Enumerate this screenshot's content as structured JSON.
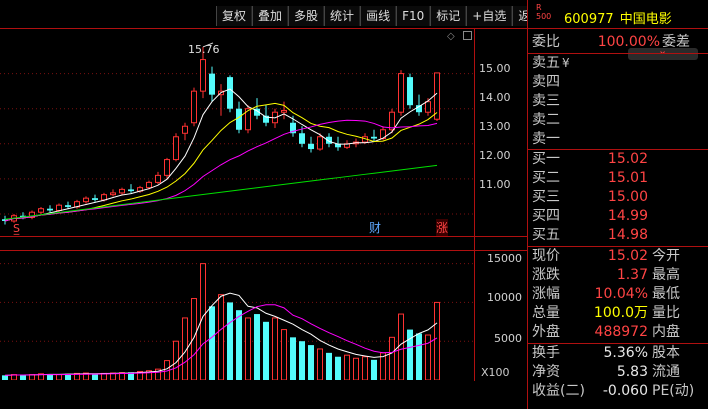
{
  "toolbar": {
    "buttons": [
      "复权",
      "叠加",
      "多股",
      "统计",
      "画线",
      "F10",
      "标记",
      "+自选",
      "返回"
    ]
  },
  "stock": {
    "r_label_top": "R",
    "r_label_bottom": "500",
    "code": "600977",
    "name": "中国电影"
  },
  "chart": {
    "high_annotation": "15.76",
    "price_axis": [
      "15.00",
      "14.00",
      "13.00",
      "12.00",
      "11.00"
    ],
    "vol_axis": [
      "15000",
      "10000",
      "5000"
    ],
    "vol_unit": "X100",
    "markers": {
      "s": "S̲",
      "cai": "财",
      "zhang": "涨"
    },
    "colors": {
      "up": "#ff3232",
      "down": "#54fcfc",
      "ma5": "#ffffff",
      "ma10": "#ffff00",
      "ma20": "#ff00ff",
      "ma60": "#00e000",
      "frame": "#b01010"
    }
  },
  "chart_data": {
    "type": "candlestick",
    "candles": [
      [
        10.85,
        10.95,
        10.7,
        10.8
      ],
      [
        10.8,
        11.0,
        10.75,
        10.95
      ],
      [
        10.95,
        11.05,
        10.85,
        10.9
      ],
      [
        10.9,
        11.1,
        10.85,
        11.05
      ],
      [
        11.05,
        11.2,
        11.0,
        11.15
      ],
      [
        11.15,
        11.25,
        11.05,
        11.1
      ],
      [
        11.1,
        11.3,
        11.05,
        11.25
      ],
      [
        11.25,
        11.35,
        11.15,
        11.2
      ],
      [
        11.2,
        11.4,
        11.15,
        11.35
      ],
      [
        11.35,
        11.5,
        11.3,
        11.45
      ],
      [
        11.45,
        11.55,
        11.35,
        11.4
      ],
      [
        11.4,
        11.6,
        11.35,
        11.55
      ],
      [
        11.55,
        11.7,
        11.5,
        11.6
      ],
      [
        11.6,
        11.75,
        11.55,
        11.7
      ],
      [
        11.7,
        11.85,
        11.6,
        11.65
      ],
      [
        11.65,
        11.8,
        11.6,
        11.75
      ],
      [
        11.75,
        11.95,
        11.7,
        11.9
      ],
      [
        11.9,
        12.2,
        11.85,
        12.1
      ],
      [
        12.1,
        12.6,
        12.0,
        12.55
      ],
      [
        12.55,
        13.3,
        12.5,
        13.2
      ],
      [
        13.3,
        13.6,
        13.1,
        13.5
      ],
      [
        13.6,
        14.6,
        13.5,
        14.5
      ],
      [
        14.5,
        15.76,
        14.3,
        15.4
      ],
      [
        15.0,
        15.2,
        14.2,
        14.4
      ],
      [
        14.4,
        14.7,
        13.8,
        14.5
      ],
      [
        14.9,
        14.95,
        13.9,
        14.0
      ],
      [
        14.0,
        14.2,
        13.3,
        13.4
      ],
      [
        13.4,
        14.1,
        13.3,
        14.0
      ],
      [
        14.0,
        14.3,
        13.7,
        13.8
      ],
      [
        13.8,
        14.1,
        13.5,
        13.6
      ],
      [
        13.6,
        14.0,
        13.45,
        13.9
      ],
      [
        13.9,
        14.2,
        13.7,
        13.95
      ],
      [
        13.6,
        13.8,
        13.2,
        13.3
      ],
      [
        13.3,
        13.5,
        12.9,
        13.0
      ],
      [
        13.0,
        13.2,
        12.75,
        12.85
      ],
      [
        12.85,
        13.3,
        12.8,
        13.2
      ],
      [
        13.2,
        13.3,
        12.9,
        13.0
      ],
      [
        13.0,
        13.2,
        12.8,
        12.9
      ],
      [
        12.9,
        13.1,
        12.85,
        13.0
      ],
      [
        13.0,
        13.15,
        12.9,
        13.05
      ],
      [
        13.05,
        13.3,
        13.0,
        13.2
      ],
      [
        13.2,
        13.4,
        13.05,
        13.15
      ],
      [
        13.15,
        13.5,
        13.1,
        13.4
      ],
      [
        13.4,
        14.0,
        13.3,
        13.9
      ],
      [
        13.9,
        15.1,
        13.8,
        15.0
      ],
      [
        14.9,
        15.0,
        14.0,
        14.1
      ],
      [
        14.1,
        14.4,
        13.8,
        13.9
      ],
      [
        13.9,
        14.3,
        13.8,
        14.2
      ],
      [
        13.7,
        15.02,
        13.65,
        15.02
      ]
    ],
    "volumes": [
      600,
      700,
      650,
      700,
      800,
      750,
      700,
      800,
      850,
      900,
      800,
      850,
      900,
      950,
      1000,
      1100,
      1200,
      1400,
      2500,
      5000,
      8000,
      10500,
      15000,
      9500,
      11000,
      10000,
      9000,
      8000,
      8500,
      7500,
      8000,
      6500,
      5500,
      5000,
      4500,
      4000,
      3500,
      3000,
      3200,
      2800,
      3000,
      2600,
      3500,
      5500,
      8500,
      6500,
      6000,
      5800,
      10000
    ]
  },
  "orders": {
    "weibi_label": "委比",
    "weibi_value": "100.00%",
    "weicha_label": "委差",
    "sell": [
      {
        "label": "卖五",
        "price": "",
        "vol": "",
        "extra": "¥"
      },
      {
        "label": "卖四",
        "price": "",
        "vol": ""
      },
      {
        "label": "卖三",
        "price": "",
        "vol": ""
      },
      {
        "label": "卖二",
        "price": "",
        "vol": ""
      },
      {
        "label": "卖一",
        "price": "",
        "vol": ""
      }
    ],
    "buy": [
      {
        "label": "买一",
        "price": "15.02"
      },
      {
        "label": "买二",
        "price": "15.01"
      },
      {
        "label": "买三",
        "price": "15.00"
      },
      {
        "label": "买四",
        "price": "14.99"
      },
      {
        "label": "买五",
        "price": "14.98"
      }
    ]
  },
  "quote": [
    {
      "label": "现价",
      "value": "15.02",
      "label2": "今开"
    },
    {
      "label": "涨跌",
      "value": "1.37",
      "label2": "最高"
    },
    {
      "label": "涨幅",
      "value": "10.04%",
      "label2": "最低"
    },
    {
      "label": "总量",
      "value": "100.0万",
      "label2": "量比"
    },
    {
      "label": "外盘",
      "value": "488972",
      "label2": "内盘"
    }
  ],
  "quote2": [
    {
      "label": "换手",
      "value": "5.36%",
      "label2": "股本"
    },
    {
      "label": "净资",
      "value": "5.83",
      "label2": "流通"
    },
    {
      "label": "收益(二)",
      "value": "-0.060",
      "label2": "PE(动)"
    }
  ]
}
